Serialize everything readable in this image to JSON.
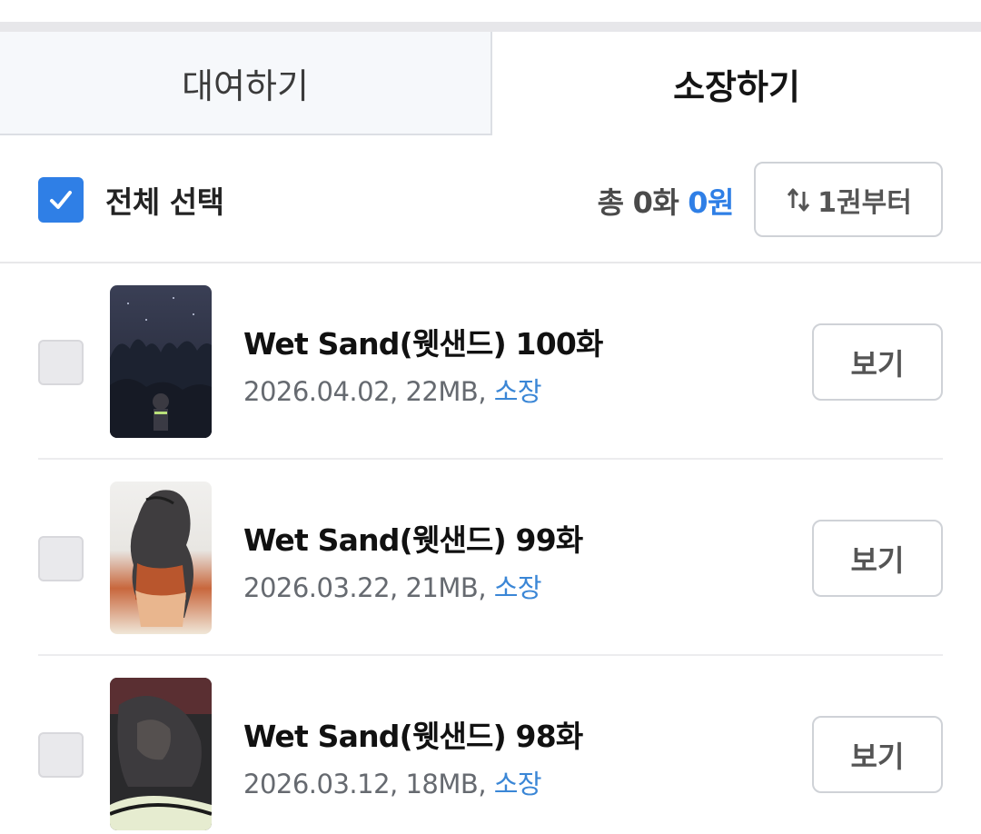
{
  "tabs": {
    "rent_label": "대여하기",
    "own_label": "소장하기",
    "active": "own"
  },
  "toolbar": {
    "select_all_label": "전체 선택",
    "select_all_checked": true,
    "summary_prefix": "총",
    "summary_count": "0화",
    "summary_price": "0원",
    "sort_label": "1권부터",
    "sort_icon": "sort-arrows-icon"
  },
  "episodes": [
    {
      "title": "Wet Sand(웻샌드) 100화",
      "date": "2026.04.02",
      "size": "22MB",
      "status": "소장",
      "view_label": "보기",
      "checked": false
    },
    {
      "title": "Wet Sand(웻샌드) 99화",
      "date": "2026.03.22",
      "size": "21MB",
      "status": "소장",
      "view_label": "보기",
      "checked": false
    },
    {
      "title": "Wet Sand(웻샌드) 98화",
      "date": "2026.03.12",
      "size": "18MB",
      "status": "소장",
      "view_label": "보기",
      "checked": false
    }
  ],
  "colors": {
    "accent_blue": "#2f7fe6",
    "owned_blue": "#3a86d6",
    "tab_inactive_bg": "#f6f8fb",
    "checkbox_unchecked": "#e9e9ec"
  }
}
